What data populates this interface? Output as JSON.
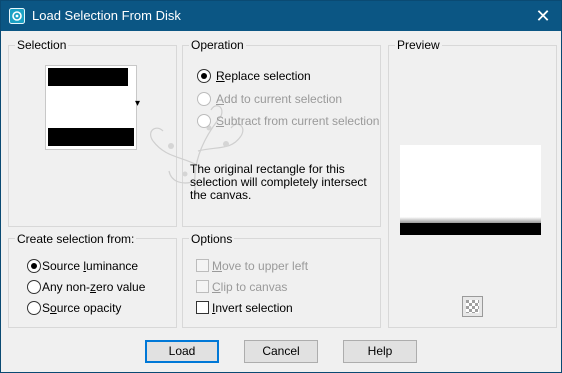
{
  "window": {
    "title": "Load Selection From Disk",
    "close_glyph": "✕"
  },
  "selection": {
    "group_label": "Selection",
    "dropdown_glyph": "▾"
  },
  "operation": {
    "group_label": "Operation",
    "options": [
      {
        "pre": "",
        "ul": "R",
        "post": "eplace selection",
        "selected": true,
        "enabled": true
      },
      {
        "pre": "",
        "ul": "A",
        "post": "dd to current selection",
        "selected": false,
        "enabled": false
      },
      {
        "pre": "",
        "ul": "S",
        "post": "ubtract from current selection",
        "selected": false,
        "enabled": false
      }
    ],
    "message_line1": "The original rectangle for this",
    "message_line2": "selection will completely intersect",
    "message_line3": "the canvas."
  },
  "preview": {
    "group_label": "Preview"
  },
  "create_from": {
    "group_label": "Create selection from:",
    "options": [
      {
        "pre": "Source ",
        "ul": "l",
        "post": "uminance",
        "selected": true
      },
      {
        "pre": "Any non-",
        "ul": "z",
        "post": "ero value",
        "selected": false
      },
      {
        "pre": "S",
        "ul": "o",
        "post": "urce opacity",
        "selected": false
      }
    ]
  },
  "options": {
    "group_label": "Options",
    "items": [
      {
        "pre": "",
        "ul": "M",
        "post": "ove to upper left",
        "checked": false,
        "enabled": false
      },
      {
        "pre": "",
        "ul": "C",
        "post": "lip to canvas",
        "checked": false,
        "enabled": false
      },
      {
        "pre": "",
        "ul": "I",
        "post": "nvert selection",
        "checked": false,
        "enabled": true
      }
    ]
  },
  "buttons": {
    "load": "Load",
    "cancel": "Cancel",
    "help": "Help"
  },
  "colors": {
    "titlebar": "#0b5684",
    "default_button_border": "#0078d7"
  }
}
